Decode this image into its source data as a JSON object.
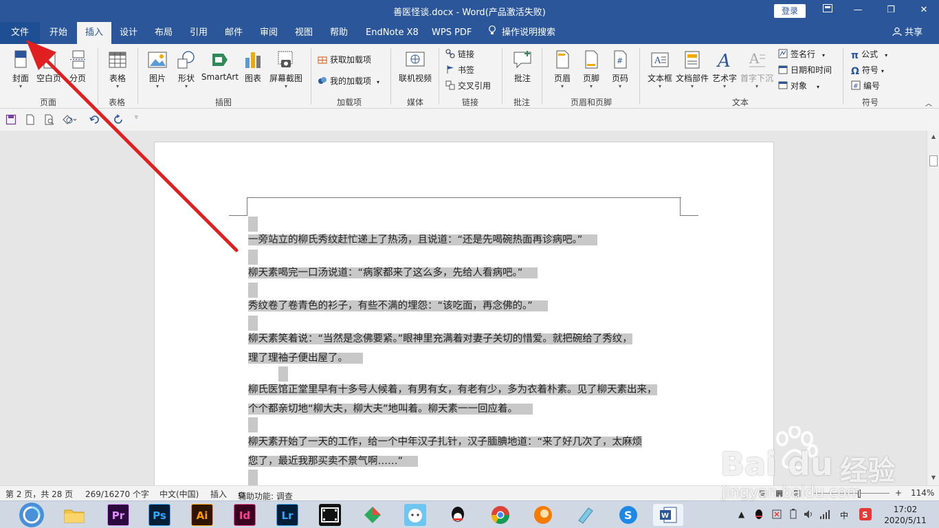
{
  "window": {
    "title": "善医怪谈.docx  -  Word(产品激活失败)",
    "login": "登录"
  },
  "tabs": [
    "文件",
    "开始",
    "插入",
    "设计",
    "布局",
    "引用",
    "邮件",
    "审阅",
    "视图",
    "帮助",
    "EndNote X8",
    "WPS PDF",
    "操作说明搜索"
  ],
  "share": "共享",
  "ribbon": {
    "pages": [
      "封面",
      "空白页",
      "分页"
    ],
    "table": "表格",
    "illus": [
      "图片",
      "形状",
      "SmartArt",
      "图表",
      "屏幕截图"
    ],
    "addins": [
      "获取加载项",
      "我的加载项"
    ],
    "media": "联机视频",
    "links": [
      "链接",
      "书签",
      "交叉引用"
    ],
    "comment": "批注",
    "hf": [
      "页眉",
      "页脚",
      "页码"
    ],
    "text": [
      "文本框",
      "文档部件",
      "艺术字",
      "首字下沉"
    ],
    "text_small": [
      "签名行",
      "日期和时间",
      "对象"
    ],
    "symbols": [
      "公式",
      "符号",
      "编号"
    ],
    "groups": [
      "页面",
      "表格",
      "插图",
      "加载项",
      "媒体",
      "链接",
      "批注",
      "页眉和页脚",
      "文本",
      "符号"
    ]
  },
  "document": {
    "paragraphs": [
      [
        "一旁站立的柳氏秀纹赶忙递上了热汤，且说道：“还是先喝碗热面再诊病吧。”"
      ],
      [
        "柳天素喝完一口汤说道：“病家都来了这么多，先给人看病吧。”"
      ],
      [
        "秀纹卷了卷青色的衫子，有些不满的埋怨：“该吃面，再念佛的。”"
      ],
      [
        "柳天素笑着说：“当然是念佛要紧。”眼神里充满着对妻子关切的惜爱。就把碗给了秀纹，",
        "理了理袖子便出屋了。"
      ],
      [
        "柳氏医馆正堂里早有十多号人候着，有男有女，有老有少，多为衣着朴素。见了柳天素出来，",
        "个个都亲切地“柳大夫，柳大夫”地叫着。柳天素一一回应着。"
      ],
      [
        "柳天素开始了一天的工作，给一个中年汉子扎针，汉子腼腆地道：“来了好几次了，太麻烦",
        "您了，最近我那买卖不景气啊……”"
      ]
    ]
  },
  "status": {
    "page": "第 2 页，共 28 页",
    "words": "269/16270 个字",
    "lang": "中文(中国)",
    "mode": "插入",
    "access": "辅助功能: 调查",
    "zoom": "114%"
  },
  "taskbar": {
    "apps": [
      "Pr",
      "Ps",
      "Ai",
      "Id",
      "Lr"
    ],
    "time": "17:02",
    "date": "2020/5/11",
    "ime": "中"
  },
  "watermark": {
    "brand": "Bai  du",
    "cn": "经验",
    "url": "jingyan.baidu.com"
  },
  "colors": {
    "word_blue": "#2b579a",
    "highlight": "#c8c8c8",
    "arrow": "#e02020"
  }
}
